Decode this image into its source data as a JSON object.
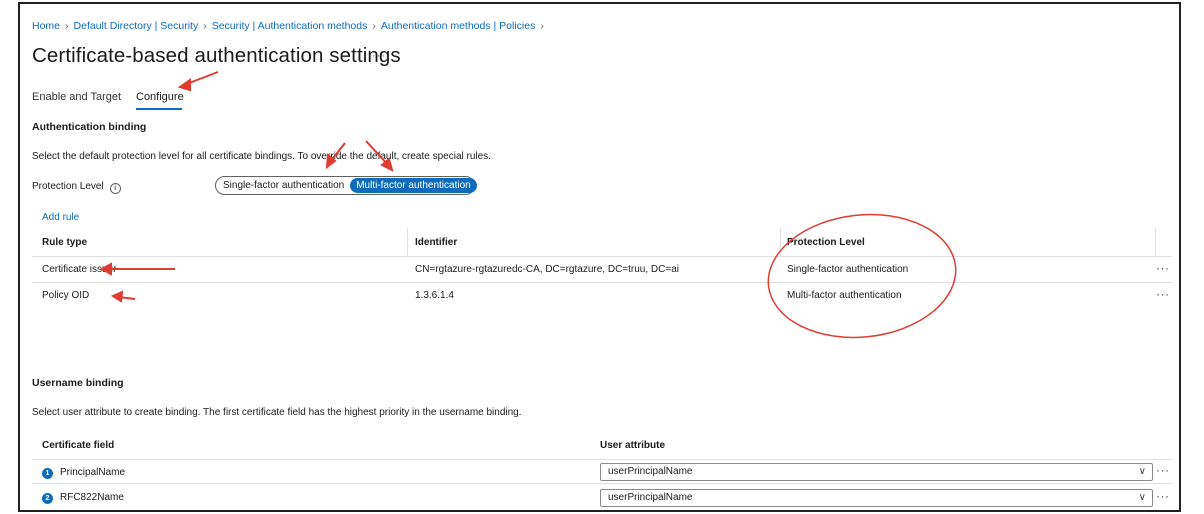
{
  "breadcrumb": [
    {
      "label": "Home"
    },
    {
      "label": "Default Directory | Security"
    },
    {
      "label": "Security | Authentication methods"
    },
    {
      "label": "Authentication methods | Policies"
    }
  ],
  "page": {
    "title": "Certificate-based authentication settings",
    "more_label": "···"
  },
  "tabs": [
    {
      "label": "Enable and Target",
      "selected": false
    },
    {
      "label": "Configure",
      "selected": true
    }
  ],
  "auth_binding": {
    "title": "Authentication binding",
    "description": "Select the default protection level for all certificate bindings. To override the default, create special rules.",
    "protection_label": "Protection Level",
    "info_icon": "i",
    "toggle_options": [
      {
        "label": "Single-factor authentication",
        "selected": false
      },
      {
        "label": "Multi-factor authentication",
        "selected": true
      }
    ],
    "add_rule": "Add rule",
    "columns": [
      "Rule type",
      "Identifier",
      "Protection Level"
    ],
    "rows": [
      {
        "rule_type": "Certificate issuer",
        "identifier": "CN=rgtazure-rgtazuredc-CA, DC=rgtazure, DC=truu, DC=ai",
        "protection": "Single-factor authentication",
        "more": "···"
      },
      {
        "rule_type": "Policy OID",
        "identifier": "1.3.6.1.4",
        "protection": "Multi-factor authentication",
        "more": "···"
      }
    ]
  },
  "username_binding": {
    "title": "Username binding",
    "description": "Select user attribute to create binding. The first certificate field has the highest priority in the username binding.",
    "columns": [
      "Certificate field",
      "User attribute"
    ],
    "rows": [
      {
        "index": "1",
        "field": "PrincipalName",
        "attribute": "userPrincipalName",
        "more": "···"
      },
      {
        "index": "2",
        "field": "RFC822Name",
        "attribute": "userPrincipalName",
        "more": "···"
      }
    ]
  },
  "icons": {
    "chevron_down": "chevron-down-icon",
    "chevron_right": "chevron-right-icon",
    "info": "info-icon",
    "more": "more-icon"
  },
  "colors": {
    "accent": "#0f6cbd",
    "annotation": "#e03c31"
  }
}
